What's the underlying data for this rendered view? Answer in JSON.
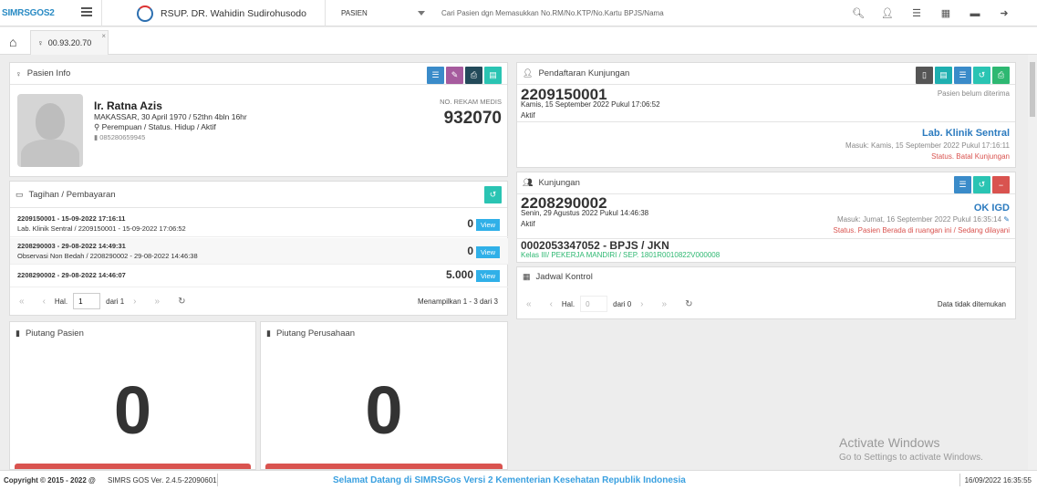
{
  "topbar": {
    "logo_text": "SIMRSGOS2",
    "hospital": "RSUP. DR. Wahidin Sudirohusodo",
    "select_value": "PASIEN",
    "search_placeholder": "Cari Pasien dgn Memasukkan No.RM/No.KTP/No.Kartu BPJS/Nama"
  },
  "tab": {
    "label": "00.93.20.70",
    "close": "×"
  },
  "patient": {
    "title": "Pasien Info",
    "name": "Ir. Ratna Azis",
    "birth": "MAKASSAR, 30 April 1970 / 52thn 4bln 16hr",
    "gender_status": "Perempuan / Status. Hidup / Aktif",
    "phone": "085280659945",
    "rm_label": "NO. REKAM MEDIS",
    "rm": "932070"
  },
  "billing": {
    "title": "Tagihan / Pembayaran",
    "rows": [
      {
        "line1": "2209150001 - 15-09-2022 17:16:11",
        "line2": "Lab. Klinik Sentral / 2209150001 - 15-09-2022 17:06:52",
        "amount": "0",
        "view": "View"
      },
      {
        "line1": "2208290003 - 29-08-2022 14:49:31",
        "line2": "Observasi Non Bedah / 2208290002 - 29-08-2022 14:46:38",
        "amount": "0",
        "view": "View"
      },
      {
        "line1": "2208290002 - 29-08-2022 14:46:07",
        "line2": "",
        "amount": "5.000",
        "view": "View"
      }
    ],
    "pager": {
      "hal": "Hal.",
      "page": "1",
      "of": "dari 1",
      "info": "Menampilkan 1 - 3 dari 3"
    }
  },
  "piutang_pasien": {
    "title": "Piutang Pasien",
    "value": "0"
  },
  "piutang_perusahaan": {
    "title": "Piutang Perusahaan",
    "value": "0"
  },
  "pendaftaran": {
    "title": "Pendaftaran Kunjungan",
    "number": "2209150001",
    "date": "Kamis, 15 September 2022 Pukul 17:06:52",
    "status": "Aktif",
    "right_status": "Pasien belum diterima",
    "unit": "Lab. Klinik Sentral",
    "masuk": "Masuk: Kamis, 15 September 2022 Pukul 17:16:11",
    "batal": "Status. Batal Kunjungan"
  },
  "kunjungan": {
    "title": "Kunjungan",
    "number": "2208290002",
    "date": "Senin, 29 Agustus 2022 Pukul 14:46:38",
    "status": "Aktif",
    "unit": "OK IGD",
    "masuk": "Masuk: Jumat, 16 September 2022 Pukul 16:35:14",
    "ruang": "Status. Pasien Berada di ruangan ini / Sedang dilayani",
    "bpjs": "0002053347052 - BPJS / JKN",
    "kelas": "Kelas III/ PEKERJA MANDIRI / SEP. 1801R0010822V000008"
  },
  "jadwal": {
    "title": "Jadwal Kontrol",
    "hal": "Hal.",
    "page": "0",
    "of": "dari 0",
    "empty": "Data tidak ditemukan"
  },
  "footer": {
    "copyright": "Copyright © 2015 - 2022 @",
    "version": "SIMRS GOS Ver. 2.4.5-22090601",
    "welcome": "Selamat Datang di SIMRSGos Versi 2 Kementerian Kesehatan Republik Indonesia",
    "datetime": "16/09/2022 16:35:55"
  },
  "watermark": {
    "title": "Activate Windows",
    "sub": "Go to Settings to activate Windows."
  },
  "colors": {
    "accent": "#3a8bc9",
    "danger": "#d9534f",
    "success": "#2eb872",
    "teal": "#2ac4b3"
  }
}
